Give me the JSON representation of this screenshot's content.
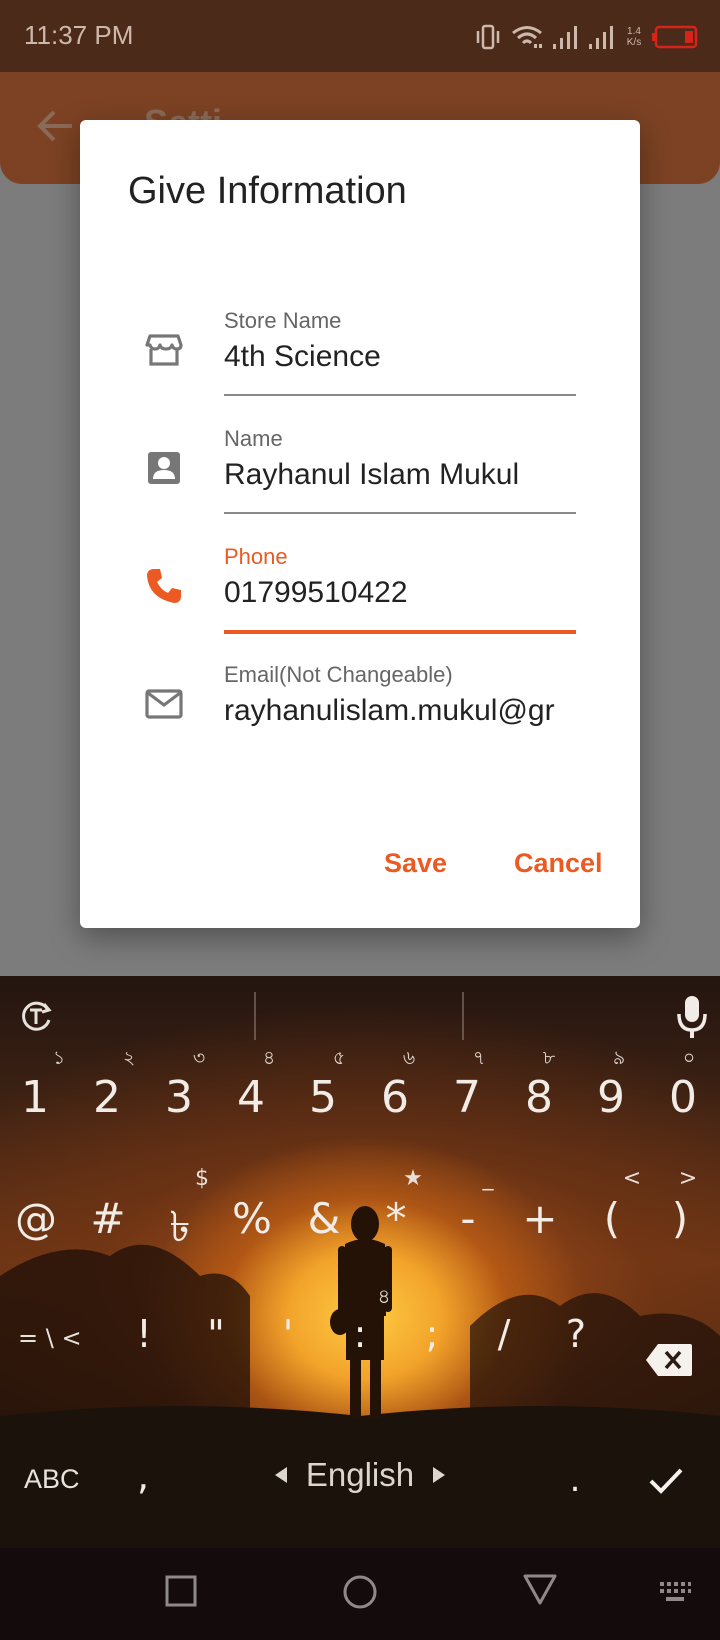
{
  "status_bar": {
    "time": "11:37 PM",
    "net_speed_value": "1.4",
    "net_speed_unit": "K/s",
    "icons": [
      "vibrate-icon",
      "wifi-icon",
      "signal-icon",
      "signal-icon",
      "battery-low-icon"
    ]
  },
  "app_bar": {
    "title": "Setti",
    "back_icon": "arrow-left-icon"
  },
  "dialog": {
    "title": "Give Information",
    "fields": [
      {
        "label": "Store Name",
        "value": "4th Science",
        "icon": "store-icon",
        "state": "normal"
      },
      {
        "label": "Name",
        "value": "Rayhanul Islam Mukul",
        "icon": "contact-icon",
        "state": "normal"
      },
      {
        "label": "Phone",
        "value": "01799510422",
        "icon": "phone-icon",
        "state": "focused"
      },
      {
        "label": "Email(Not Changeable)",
        "value": "rayhanulislam.mukul@gr",
        "icon": "mail-icon",
        "state": "disabled"
      }
    ],
    "save_label": "Save",
    "cancel_label": "Cancel"
  },
  "keyboard": {
    "numbers": [
      "1",
      "2",
      "3",
      "4",
      "5",
      "6",
      "7",
      "8",
      "9",
      "0"
    ],
    "bengali_digits": [
      "১",
      "২",
      "৩",
      "৪",
      "৫",
      "৬",
      "৭",
      "৮",
      "৯",
      "০"
    ],
    "symbols": [
      "@",
      "#",
      "৳",
      "%",
      "&",
      "*",
      "-",
      "+",
      "(",
      ")"
    ],
    "symbol_hints": [
      "",
      "",
      "$",
      "",
      "",
      "★",
      "_",
      "",
      "<",
      ">"
    ],
    "row3": [
      "!",
      "\"",
      "'",
      ":",
      ";",
      "/",
      "?"
    ],
    "row3_hint": "৪",
    "more_symbols_label": "= \\ <",
    "abc_label": "ABC",
    "comma": ",",
    "language": "English",
    "period": "."
  },
  "colors": {
    "accent": "#ea5a22",
    "status_bar": "#4c2a19",
    "app_bar": "#7c4223",
    "scrim": "#7c7c7c"
  }
}
